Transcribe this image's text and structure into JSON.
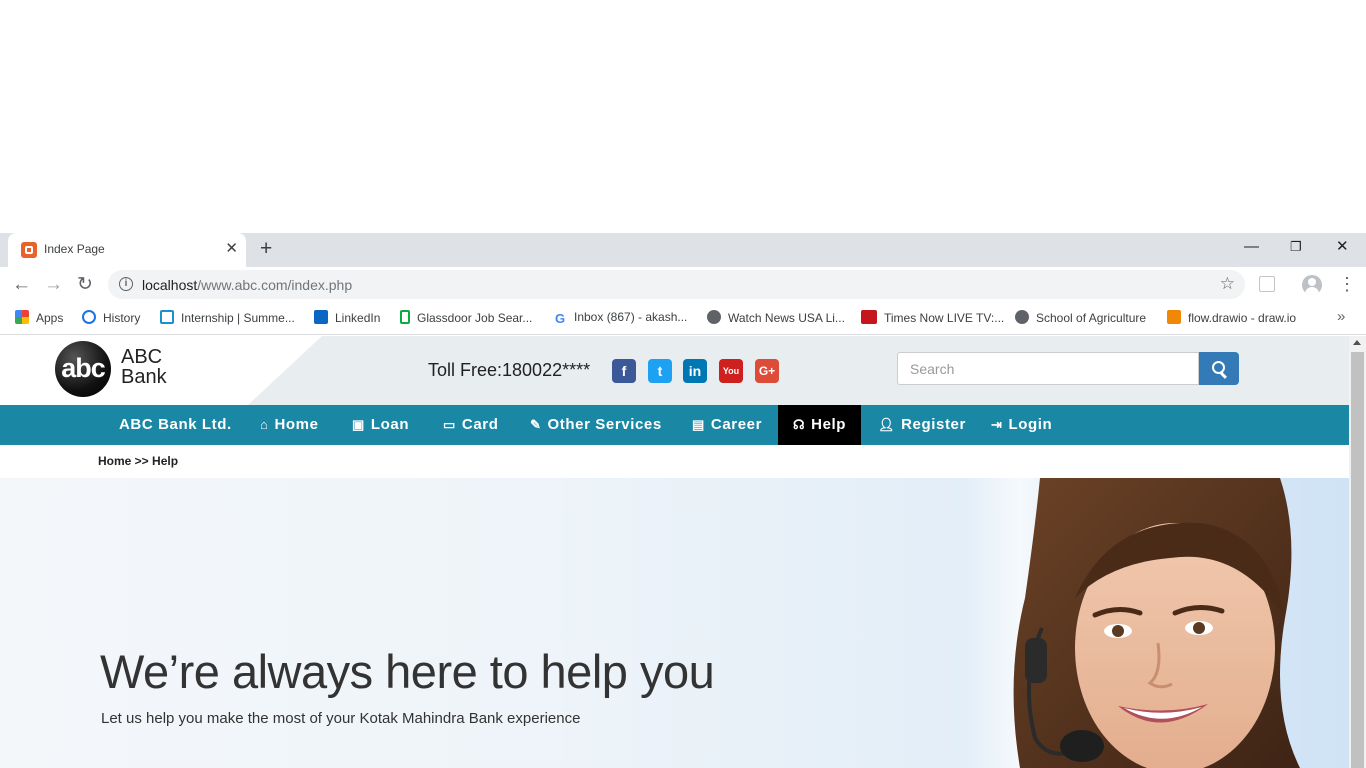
{
  "browser": {
    "tab_title": "Index Page",
    "url_host": "localhost",
    "url_path": "/www.abc.com/index.php",
    "bookmarks": [
      {
        "label": "Apps",
        "icon": "apps-grid-icon",
        "color": "#4285f4"
      },
      {
        "label": "History",
        "icon": "history-icon",
        "color": "#1a73e8"
      },
      {
        "label": "Internship | Summe...",
        "icon": "internshala-icon",
        "color": "#1c8fd1"
      },
      {
        "label": "LinkedIn",
        "icon": "linkedin-icon",
        "color": "#0a66c2"
      },
      {
        "label": "Glassdoor Job Sear...",
        "icon": "glassdoor-icon",
        "color": "#0caa41"
      },
      {
        "label": "Inbox (867) - akash...",
        "icon": "google-icon",
        "color": "#ea4335"
      },
      {
        "label": "Watch News USA Li...",
        "icon": "globe-icon",
        "color": "#5f6368"
      },
      {
        "label": "Times Now LIVE TV:...",
        "icon": "times-now-icon",
        "color": "#c4161c"
      },
      {
        "label": "School of Agriculture",
        "icon": "globe-icon",
        "color": "#5f6368"
      },
      {
        "label": "flow.drawio - draw.io",
        "icon": "drawio-icon",
        "color": "#f08705"
      }
    ]
  },
  "site": {
    "logo_mark": "abc",
    "logo_line1": "ABC",
    "logo_line2": "Bank",
    "toll_free": "Toll Free:180022****",
    "social": [
      {
        "name": "facebook-icon",
        "glyph": "f",
        "color": "#3b5998"
      },
      {
        "name": "twitter-icon",
        "glyph": "t",
        "color": "#1da1f2"
      },
      {
        "name": "linkedin-icon",
        "glyph": "in",
        "color": "#0077b5"
      },
      {
        "name": "youtube-icon",
        "glyph": "You",
        "color": "#cd201f"
      },
      {
        "name": "google-plus-icon",
        "glyph": "G+",
        "color": "#dd4b39"
      }
    ],
    "search_placeholder": "Search",
    "nav": {
      "brand": "ABC Bank Ltd.",
      "home": "Home",
      "loan": "Loan",
      "card": "Card",
      "other_services": "Other Services",
      "career": "Career",
      "help": "Help",
      "register": "Register",
      "login": "Login"
    },
    "breadcrumb": "Home >> Help",
    "hero_title": "We’re always here to help you",
    "hero_subtitle": "Let us help you make the most of your Kotak Mahindra Bank experience"
  }
}
